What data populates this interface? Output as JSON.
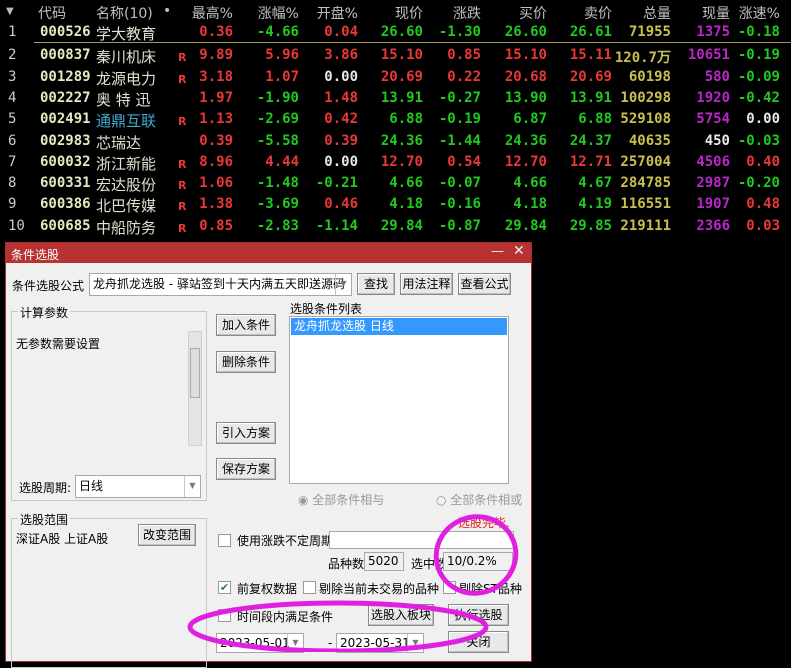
{
  "table": {
    "headers": [
      "代码",
      "名称(10)",
      "•",
      "最高%",
      "涨幅%",
      "开盘%",
      "现价",
      "涨跌",
      "买价",
      "卖价",
      "总量",
      "现量",
      "涨速%"
    ],
    "sort_icon": "triangle-down-icon",
    "rows": [
      {
        "idx": "1",
        "code": "000526",
        "name": "学大教育",
        "r": "",
        "high": "0.36",
        "chg": "-4.66",
        "open": "0.04",
        "price": "26.60",
        "diff": "-1.30",
        "bid": "26.60",
        "ask": "26.61",
        "vol": "71955",
        "cur": "1375",
        "speed": "-0.18"
      },
      {
        "idx": "2",
        "code": "000837",
        "name": "秦川机床",
        "r": "R",
        "high": "9.89",
        "chg": "5.96",
        "open": "3.86",
        "price": "15.10",
        "diff": "0.85",
        "bid": "15.10",
        "ask": "15.11",
        "vol": "120.7万",
        "cur": "10651",
        "speed": "-0.19"
      },
      {
        "idx": "3",
        "code": "001289",
        "name": "龙源电力",
        "r": "R",
        "high": "3.18",
        "chg": "1.07",
        "open": "0.00",
        "price": "20.69",
        "diff": "0.22",
        "bid": "20.68",
        "ask": "20.69",
        "vol": "60198",
        "cur": "580",
        "speed": "-0.09"
      },
      {
        "idx": "4",
        "code": "002227",
        "name": "奥 特 迅",
        "r": "",
        "high": "1.97",
        "chg": "-1.90",
        "open": "1.48",
        "price": "13.91",
        "diff": "-0.27",
        "bid": "13.90",
        "ask": "13.91",
        "vol": "100298",
        "cur": "1920",
        "speed": "-0.42"
      },
      {
        "idx": "5",
        "code": "002491",
        "name": "通鼎互联",
        "r": "R",
        "high": "1.13",
        "chg": "-2.69",
        "open": "0.42",
        "price": "6.88",
        "diff": "-0.19",
        "bid": "6.87",
        "ask": "6.88",
        "vol": "529108",
        "cur": "5754",
        "speed": "0.00"
      },
      {
        "idx": "6",
        "code": "002983",
        "name": "芯瑞达",
        "r": "",
        "high": "0.39",
        "chg": "-5.58",
        "open": "0.39",
        "price": "24.36",
        "diff": "-1.44",
        "bid": "24.36",
        "ask": "24.37",
        "vol": "40635",
        "cur": "450",
        "speed": "-0.03"
      },
      {
        "idx": "7",
        "code": "600032",
        "name": "浙江新能",
        "r": "R",
        "high": "8.96",
        "chg": "4.44",
        "open": "0.00",
        "price": "12.70",
        "diff": "0.54",
        "bid": "12.70",
        "ask": "12.71",
        "vol": "257004",
        "cur": "4506",
        "speed": "0.40"
      },
      {
        "idx": "8",
        "code": "600331",
        "name": "宏达股份",
        "r": "R",
        "high": "1.06",
        "chg": "-1.48",
        "open": "-0.21",
        "price": "4.66",
        "diff": "-0.07",
        "bid": "4.66",
        "ask": "4.67",
        "vol": "284785",
        "cur": "2987",
        "speed": "-0.20"
      },
      {
        "idx": "9",
        "code": "600386",
        "name": "北巴传媒",
        "r": "R",
        "high": "1.38",
        "chg": "-3.69",
        "open": "0.46",
        "price": "4.18",
        "diff": "-0.16",
        "bid": "4.18",
        "ask": "4.19",
        "vol": "116551",
        "cur": "1907",
        "speed": "0.48"
      },
      {
        "idx": "10",
        "code": "600685",
        "name": "中船防务",
        "r": "R",
        "high": "0.85",
        "chg": "-2.83",
        "open": "-1.14",
        "price": "29.84",
        "diff": "-0.87",
        "bid": "29.84",
        "ask": "29.85",
        "vol": "219111",
        "cur": "2366",
        "speed": "0.03"
      }
    ]
  },
  "dialog": {
    "title": "条件选股",
    "formula_label": "条件选股公式",
    "formula_value": "龙舟抓龙选股 - 驿站签到十天内满五天即送源码",
    "find": "查找",
    "usage": "用法注释",
    "view": "查看公式",
    "params_group": "计算参数",
    "params_text": "无参数需要设置",
    "period_label": "选股周期:",
    "period_value": "日线",
    "range_group": "选股范围",
    "range_text": "深证A股 上证A股",
    "change_range": "改变范围",
    "add": "加入条件",
    "delete": "删除条件",
    "import": "引入方案",
    "save": "保存方案",
    "list_label": "选股条件列表",
    "list_items": [
      "龙舟抓龙选股  日线"
    ],
    "radio_and": "全部条件相与",
    "radio_or": "全部条件相或",
    "status": "选股完毕.",
    "variable_period": "使用涨跌不定周期",
    "count_label": "品种数",
    "count_value": "5020",
    "selected_label": "选中数",
    "selected_value": "10/0.2%",
    "adjusted": "前复权数据",
    "exclude_untraded": "剔除当前未交易的品种",
    "exclude_st": "剔除ST品种",
    "time_range": "时间段内满足条件",
    "to_block": "选股入板块",
    "execute": "执行选股",
    "date_from": "2023-05-01",
    "date_sep": "-",
    "date_to": "2023-05-31",
    "close": "关闭"
  },
  "colors": {
    "up": "#e83838",
    "down": "#22c822",
    "annotation": "#e020e0",
    "title_bar": "#b83232"
  }
}
